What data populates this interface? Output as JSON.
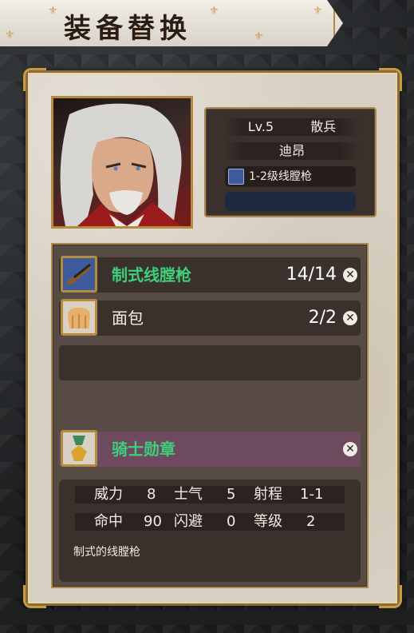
{
  "title": "装备替换",
  "hero": {
    "level": "Lv.5",
    "class": "散兵",
    "name": "迪昂",
    "weapon": "1-2级线膛枪"
  },
  "equipment": [
    {
      "name": "制式线膛枪",
      "count": "14/14",
      "icon": "rifle-icon"
    },
    {
      "name": "面包",
      "count": "2/2",
      "icon": "bread-icon"
    }
  ],
  "medal": {
    "name": "骑士勋章",
    "icon": "medal-icon"
  },
  "stats": {
    "row1": [
      {
        "label": "威力",
        "value": "8"
      },
      {
        "label": "士气",
        "value": "5"
      },
      {
        "label": "射程",
        "value": "1-1"
      }
    ],
    "row2": [
      {
        "label": "命中",
        "value": "90"
      },
      {
        "label": "闪避",
        "value": "0"
      },
      {
        "label": "等级",
        "value": "2"
      }
    ],
    "description": "制式的线膛枪"
  },
  "colors": {
    "green_text": "#3ed07a",
    "gold_border": "#b48a3e",
    "panel_brown": "#574b43"
  }
}
